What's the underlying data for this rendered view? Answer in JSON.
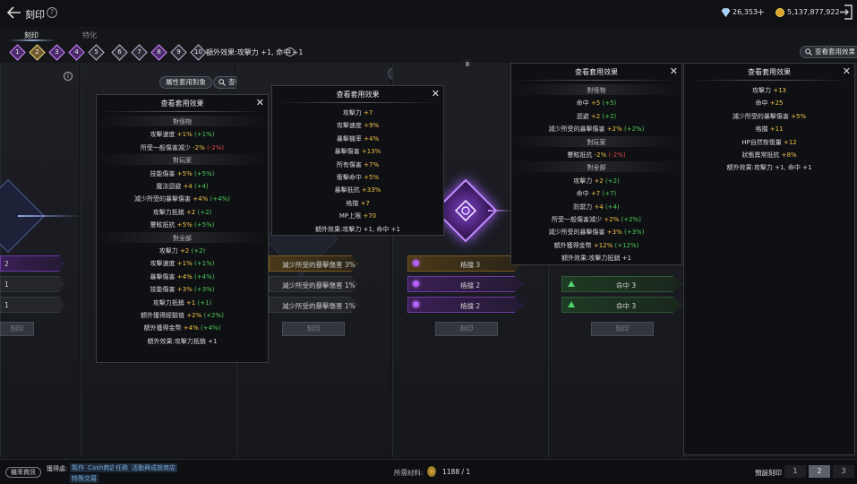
{
  "header": {
    "title": "刻印",
    "gems": "26,353",
    "plus": "+",
    "gold": "5,137,877,922"
  },
  "tabs": [
    {
      "label": "刻印"
    },
    {
      "label": "特化"
    }
  ],
  "runes": [
    {
      "n": "1",
      "style": "pu"
    },
    {
      "n": "2",
      "style": "sel"
    },
    {
      "n": "3",
      "style": "pu"
    },
    {
      "n": "4",
      "style": "pu"
    },
    {
      "n": "5",
      "style": ""
    },
    {
      "n": "6",
      "style": ""
    },
    {
      "n": "7",
      "style": ""
    },
    {
      "n": "8",
      "style": "pu"
    },
    {
      "n": "9",
      "style": ""
    },
    {
      "n": "10",
      "style": ""
    }
  ],
  "tray_effect": "額外效果:攻擊力 +1, 命中 +1",
  "view_effect_btn": "查看套用效果",
  "apply_target_btn": "屬性套用對象",
  "badge_8": "8",
  "cards": {
    "c1": {
      "slots": [
        "2",
        "1",
        "1"
      ],
      "engrave": "刻印"
    },
    "c2": {
      "slots": [
        "減少所受的暴擊傷害 3%",
        "減少所受的暴擊傷害 1%",
        "減少所受的暴擊傷害 1%"
      ],
      "engrave": "刻印"
    },
    "c3": {
      "slots": [
        "格擋 3",
        "格擋 2",
        "格擋 2"
      ],
      "engrave": "刻印"
    },
    "c4": {
      "slots": [
        "命中 3",
        "命中 3"
      ],
      "engrave": "刻印"
    }
  },
  "popup1": {
    "title": "查看套用效果",
    "rows": [
      {
        "type": "hdr",
        "text": "對怪物"
      },
      {
        "label": "攻擊速度",
        "val": "+1%",
        "diff": "(+1%)",
        "dc": "d"
      },
      {
        "label": "所受一般傷害減少",
        "val": "-2%",
        "diff": "(-2%)",
        "dc": "r"
      },
      {
        "type": "hdr",
        "text": "對玩家"
      },
      {
        "label": "技能傷害",
        "val": "+5%",
        "diff": "(+5%)",
        "dc": "d"
      },
      {
        "label": "魔法迴避",
        "val": "+4",
        "diff": "(+4)",
        "dc": "d"
      },
      {
        "label": "減少所受的暴擊傷害",
        "val": "+4%",
        "diff": "(+4%)",
        "dc": "d"
      },
      {
        "label": "攻擊力抵銷",
        "val": "+2",
        "diff": "(+2)",
        "dc": "d"
      },
      {
        "label": "暈眩抵抗",
        "val": "+5%",
        "diff": "(+5%)",
        "dc": "d"
      },
      {
        "type": "hdr",
        "text": "對全部"
      },
      {
        "label": "攻擊力",
        "val": "+2",
        "diff": "(+2)",
        "dc": "d"
      },
      {
        "label": "攻擊速度",
        "val": "+1%",
        "diff": "(+1%)",
        "dc": "d"
      },
      {
        "label": "暴擊傷害",
        "val": "+4%",
        "diff": "(+4%)",
        "dc": "d"
      },
      {
        "label": "技能傷害",
        "val": "+3%",
        "diff": "(+3%)",
        "dc": "d"
      },
      {
        "label": "攻擊力抵銷",
        "val": "+1",
        "diff": "(+1)",
        "dc": "d"
      },
      {
        "label": "額外獲得經驗值",
        "val": "+2%",
        "diff": "(+2%)",
        "dc": "d"
      },
      {
        "label": "額外獲得金幣",
        "val": "+4%",
        "diff": "(+4%)",
        "dc": "d"
      },
      {
        "type": "plain",
        "text": "額外效果:攻擊力抵銷 +1"
      }
    ]
  },
  "popup2": {
    "title": "查看套用效果",
    "rows": [
      {
        "label": "攻擊力",
        "val": "+7"
      },
      {
        "label": "攻擊速度",
        "val": "+9%"
      },
      {
        "label": "暴擊機率",
        "val": "+4%"
      },
      {
        "label": "暴擊傷害",
        "val": "+13%"
      },
      {
        "label": "所有傷害",
        "val": "+7%"
      },
      {
        "label": "衝擊命中",
        "val": "+5%"
      },
      {
        "label": "暴擊抵抗",
        "val": "+33%"
      },
      {
        "label": "格擋",
        "val": "+7"
      },
      {
        "label": "MP上限",
        "val": "+70"
      },
      {
        "type": "plain",
        "text": "額外效果:攻擊力 +1, 命中 +1"
      }
    ]
  },
  "popup3": {
    "title": "查看套用效果",
    "rows": [
      {
        "type": "hdr",
        "text": "對怪物"
      },
      {
        "label": "命中",
        "val": "+5",
        "diff": "(+5)",
        "dc": "d"
      },
      {
        "label": "迴避",
        "val": "+2",
        "diff": "(+2)",
        "dc": "d"
      },
      {
        "label": "減少所受的暴擊傷害",
        "val": "+2%",
        "diff": "(+2%)",
        "dc": "d"
      },
      {
        "type": "hdr",
        "text": "對玩家"
      },
      {
        "label": "暈眩抵抗",
        "val": "-2%",
        "diff": "(-2%)",
        "dc": "r"
      },
      {
        "type": "hdr",
        "text": "對全部"
      },
      {
        "label": "攻擊力",
        "val": "+2",
        "diff": "(+2)",
        "dc": "d"
      },
      {
        "label": "命中",
        "val": "+7",
        "diff": "(+7)",
        "dc": "d"
      },
      {
        "label": "防禦力",
        "val": "+4",
        "diff": "(+4)",
        "dc": "d"
      },
      {
        "label": "所受一般傷害減少",
        "val": "+2%",
        "diff": "(+2%)",
        "dc": "d"
      },
      {
        "label": "減少所受的暴擊傷害",
        "val": "+3%",
        "diff": "(+3%)",
        "dc": "d"
      },
      {
        "label": "額外獲得金幣",
        "val": "+12%",
        "diff": "(+12%)",
        "dc": "d"
      },
      {
        "type": "plain",
        "text": "額外效果:攻擊力抵銷 +1"
      }
    ]
  },
  "popup4": {
    "title": "查看套用效果",
    "rows": [
      {
        "label": "攻擊力",
        "val": "+13"
      },
      {
        "label": "命中",
        "val": "+25"
      },
      {
        "label": "減少所受的暴擊傷害",
        "val": "+5%"
      },
      {
        "label": "格擋",
        "val": "+11"
      },
      {
        "label": "HP自然恢復量",
        "val": "+12"
      },
      {
        "label": "狀態異常抵抗",
        "val": "+8%"
      },
      {
        "type": "plain",
        "text": "額外效果:攻擊力 +1, 命中 +1"
      }
    ]
  },
  "footer": {
    "probability_btn": "機率資訊",
    "acquire_label": "獲得處:",
    "acquire_tags": [
      "製作",
      "Cash商店",
      "任務",
      "活動與成就商店",
      "特殊交易"
    ],
    "material_label": "所需材料:",
    "material_val": "1188 / 1",
    "preset_label": "預設刻印",
    "presets": [
      "1",
      "2",
      "3"
    ],
    "active_preset": 1
  },
  "colors": {
    "value_gold": "#f1c248",
    "diff_green": "#4fca5a",
    "diff_red": "#e24848",
    "rune_purple": "#b560ff"
  }
}
